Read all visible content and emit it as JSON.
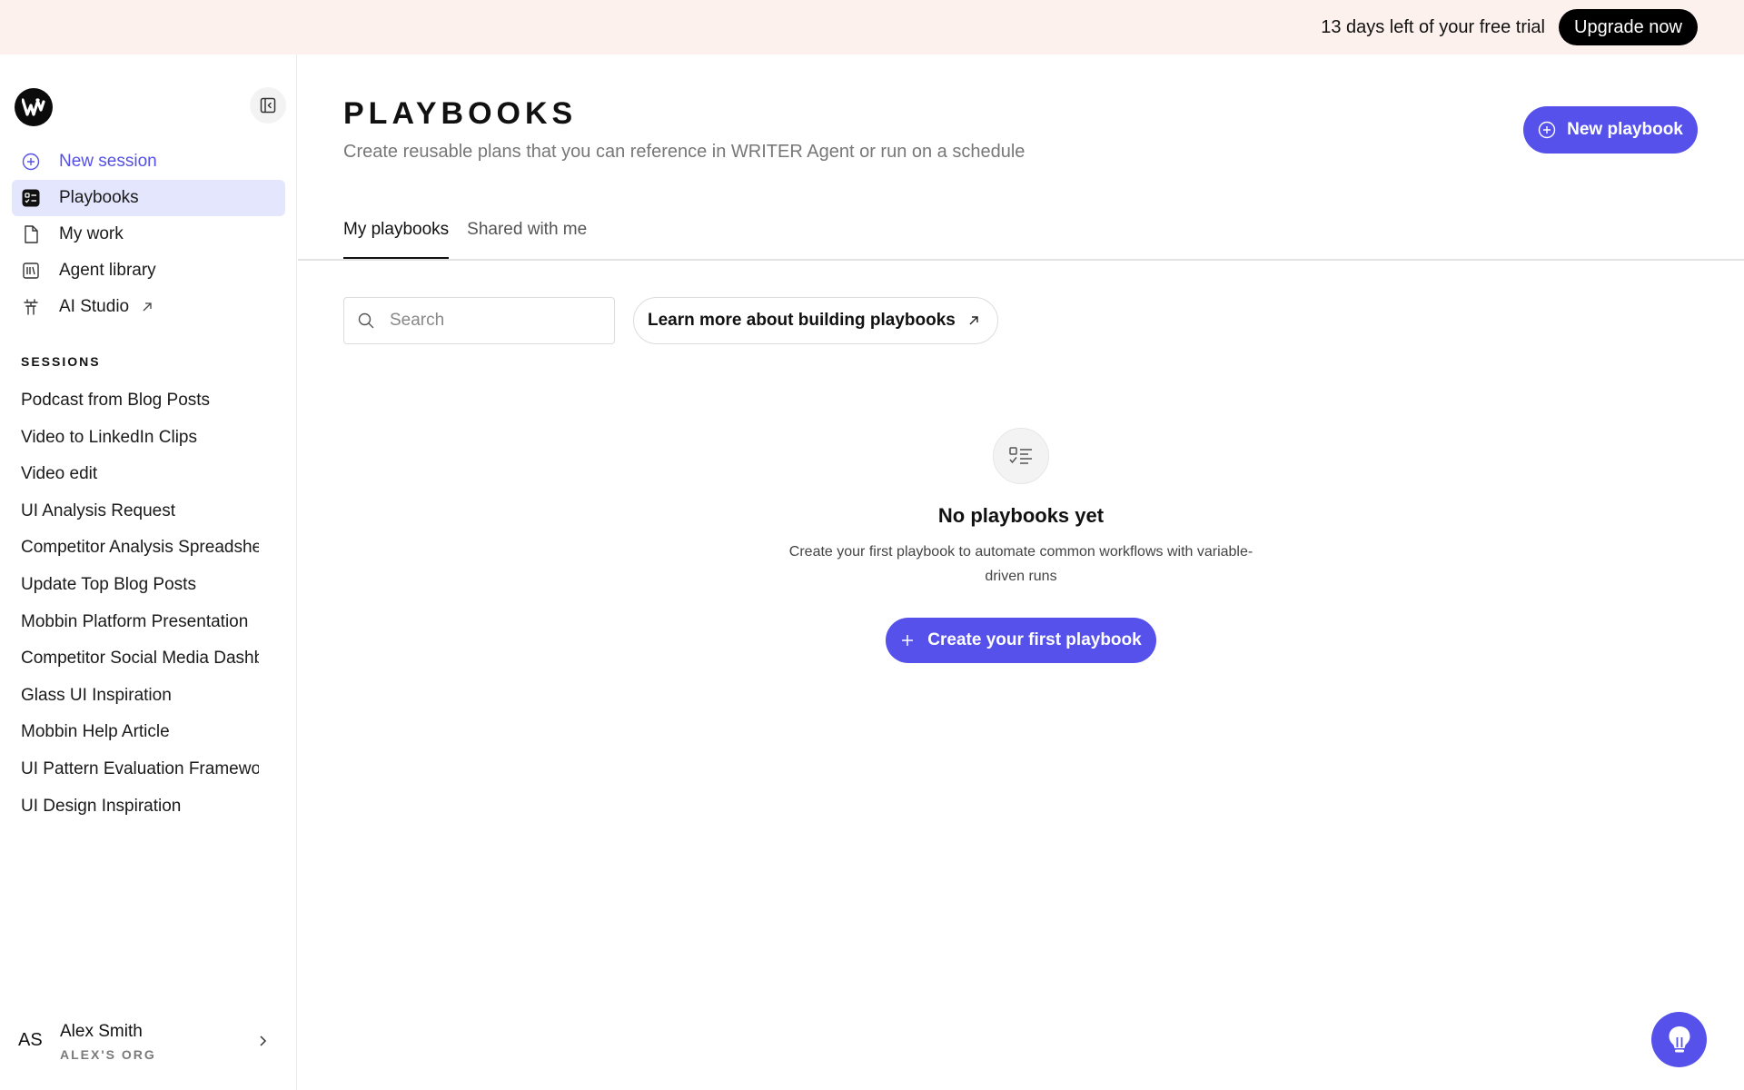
{
  "banner": {
    "trial_text": "13 days left of your free trial",
    "upgrade_label": "Upgrade now"
  },
  "sidebar": {
    "logo_icon": "writer-logo-icon",
    "nav": [
      {
        "label": "New session",
        "icon": "plus-circle-icon"
      },
      {
        "label": "Playbooks",
        "icon": "playbook-icon"
      },
      {
        "label": "My work",
        "icon": "document-icon"
      },
      {
        "label": "Agent library",
        "icon": "library-icon"
      },
      {
        "label": "AI Studio",
        "icon": "studio-icon"
      }
    ],
    "sessions_heading": "SESSIONS",
    "sessions": [
      "Podcast from Blog Posts",
      "Video to LinkedIn Clips",
      "Video edit",
      "UI Analysis Request",
      "Competitor Analysis Spreadsheet",
      "Update Top Blog Posts",
      "Mobbin Platform Presentation",
      "Competitor Social Media Dashboard",
      "Glass UI Inspiration",
      "Mobbin Help Article",
      "UI Pattern Evaluation Framework",
      "UI Design Inspiration"
    ],
    "user": {
      "initials": "AS",
      "name": "Alex Smith",
      "org": "ALEX'S ORG"
    }
  },
  "main": {
    "title": "PLAYBOOKS",
    "subtitle": "Create reusable plans that you can reference in WRITER Agent or run on a schedule",
    "new_playbook_label": "New playbook",
    "tabs": [
      {
        "label": "My playbooks",
        "active": true
      },
      {
        "label": "Shared with me",
        "active": false
      }
    ],
    "search_placeholder": "Search",
    "learn_more_label": "Learn more about building playbooks",
    "empty_state": {
      "title": "No playbooks yet",
      "description": "Create your first playbook to automate common workflows with variable-driven runs",
      "cta_label": "Create your first playbook"
    }
  },
  "colors": {
    "accent": "#5551ea",
    "banner_bg": "#fdf1ee",
    "active_nav_bg": "#e4e6fd"
  }
}
